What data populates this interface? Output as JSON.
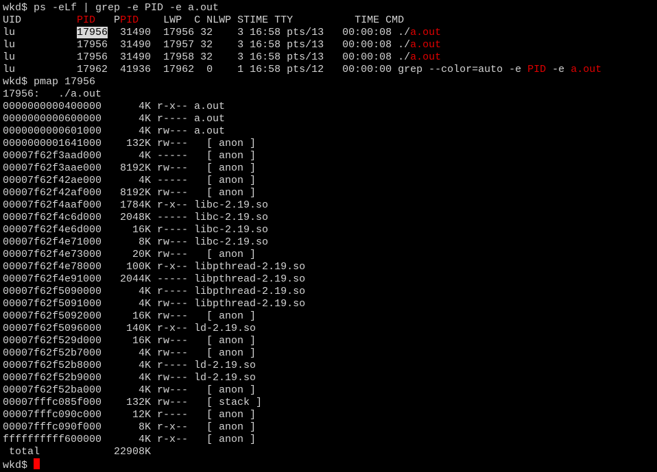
{
  "prompt": "wkd$ ",
  "cmd1": "ps -eLf | grep -e PID -e a.out",
  "ps_header": {
    "uid": "UID",
    "pre": "         ",
    "pid": "PID",
    "gap": "   P",
    "ppid": "PID",
    "rest": "    LWP  C NLWP STIME TTY          TIME CMD"
  },
  "ps_rows": [
    {
      "uid": "lu",
      "pid": "17956",
      "rest": "  31490  17956 32    3 16:58 pts/13   00:00:08 ",
      "cmd": "./",
      "cmd_red": "a.out"
    },
    {
      "uid": "lu",
      "pid": "17956",
      "rest": "  31490  17957 32    3 16:58 pts/13   00:00:08 ",
      "cmd": "./",
      "cmd_red": "a.out"
    },
    {
      "uid": "lu",
      "pid": "17956",
      "rest": "  31490  17958 32    3 16:58 pts/13   00:00:08 ",
      "cmd": "./",
      "cmd_red": "a.out"
    }
  ],
  "ps_grep_row": {
    "uid": "lu",
    "pid": "17962",
    "rest": "  41936  17962  0    1 16:58 pts/12   00:00:00 ",
    "cmd_a": "grep --color=auto -e ",
    "cmd_pid": "PID",
    "cmd_b": " -e ",
    "cmd_aout": "a.out"
  },
  "cmd2": "pmap 17956",
  "pmap_header": "17956:   ./a.out",
  "pmap_rows": [
    "0000000000400000      4K r-x-- a.out",
    "0000000000600000      4K r---- a.out",
    "0000000000601000      4K rw--- a.out",
    "0000000001641000    132K rw---   [ anon ]",
    "00007f62f3aad000      4K -----   [ anon ]",
    "00007f62f3aae000   8192K rw---   [ anon ]",
    "00007f62f42ae000      4K -----   [ anon ]",
    "00007f62f42af000   8192K rw---   [ anon ]",
    "00007f62f4aaf000   1784K r-x-- libc-2.19.so",
    "00007f62f4c6d000   2048K ----- libc-2.19.so",
    "00007f62f4e6d000     16K r---- libc-2.19.so",
    "00007f62f4e71000      8K rw--- libc-2.19.so",
    "00007f62f4e73000     20K rw---   [ anon ]",
    "00007f62f4e78000    100K r-x-- libpthread-2.19.so",
    "00007f62f4e91000   2044K ----- libpthread-2.19.so",
    "00007f62f5090000      4K r---- libpthread-2.19.so",
    "00007f62f5091000      4K rw--- libpthread-2.19.so",
    "00007f62f5092000     16K rw---   [ anon ]",
    "00007f62f5096000    140K r-x-- ld-2.19.so",
    "00007f62f529d000     16K rw---   [ anon ]",
    "00007f62f52b7000      4K rw---   [ anon ]",
    "00007f62f52b8000      4K r---- ld-2.19.so",
    "00007f62f52b9000      4K rw--- ld-2.19.so",
    "00007f62f52ba000      4K rw---   [ anon ]",
    "00007fffc085f000    132K rw---   [ stack ]",
    "00007fffc090c000     12K r----   [ anon ]",
    "00007fffc090f000      8K r-x--   [ anon ]",
    "ffffffffff600000      4K r-x--   [ anon ]"
  ],
  "pmap_total": " total            22908K",
  "colors": {
    "background": "#000000",
    "text": "#d3d3d3",
    "highlight": "#e00000",
    "cursor": "#ff0000"
  }
}
